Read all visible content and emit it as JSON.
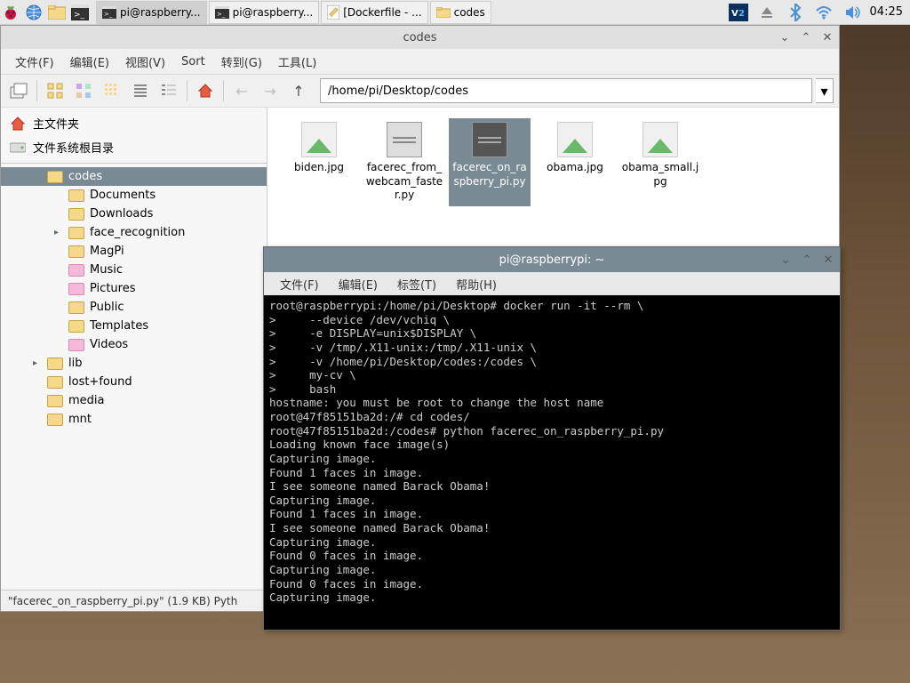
{
  "taskbar": {
    "items": [
      {
        "label": "pi@raspberry...",
        "icon": "terminal"
      },
      {
        "label": "pi@raspberry...",
        "icon": "terminal"
      },
      {
        "label": "[Dockerfile - ...",
        "icon": "editor"
      },
      {
        "label": "codes",
        "icon": "folder"
      }
    ],
    "clock": "04:25"
  },
  "file_manager": {
    "title": "codes",
    "menus": [
      "文件(F)",
      "编辑(E)",
      "视图(V)",
      "Sort",
      "转到(G)",
      "工具(L)"
    ],
    "path": "/home/pi/Desktop/codes",
    "places": [
      {
        "label": "主文件夹",
        "icon": "home"
      },
      {
        "label": "文件系统根目录",
        "icon": "drive"
      }
    ],
    "tree": [
      {
        "label": "codes",
        "level": 1,
        "selected": true
      },
      {
        "label": "Documents",
        "level": 2
      },
      {
        "label": "Downloads",
        "level": 2
      },
      {
        "label": "face_recognition",
        "level": 2,
        "expandable": true
      },
      {
        "label": "MagPi",
        "level": 2
      },
      {
        "label": "Music",
        "level": 2,
        "pink": true
      },
      {
        "label": "Pictures",
        "level": 2,
        "pink": true
      },
      {
        "label": "Public",
        "level": 2
      },
      {
        "label": "Templates",
        "level": 2
      },
      {
        "label": "Videos",
        "level": 2,
        "pink": true
      },
      {
        "label": "lib",
        "level": 1,
        "expandable": true
      },
      {
        "label": "lost+found",
        "level": 1
      },
      {
        "label": "media",
        "level": 1
      },
      {
        "label": "mnt",
        "level": 1
      }
    ],
    "files": [
      {
        "name": "biden.jpg",
        "type": "image"
      },
      {
        "name": "facerec_from_webcam_faster.py",
        "type": "text"
      },
      {
        "name": "facerec_on_raspberry_pi.py",
        "type": "text-dark",
        "selected": true
      },
      {
        "name": "obama.jpg",
        "type": "image"
      },
      {
        "name": "obama_small.jpg",
        "type": "image"
      }
    ],
    "status": "\"facerec_on_raspberry_pi.py\" (1.9 KB) Pyth"
  },
  "terminal": {
    "title": "pi@raspberrypi: ~",
    "menus": [
      "文件(F)",
      "编辑(E)",
      "标签(T)",
      "帮助(H)"
    ],
    "lines": [
      "root@raspberrypi:/home/pi/Desktop# docker run -it --rm \\",
      ">     --device /dev/vchiq \\",
      ">     -e DISPLAY=unix$DISPLAY \\",
      ">     -v /tmp/.X11-unix:/tmp/.X11-unix \\",
      ">     -v /home/pi/Desktop/codes:/codes \\",
      ">     my-cv \\",
      ">     bash",
      "hostname: you must be root to change the host name",
      "root@47f85151ba2d:/# cd codes/",
      "root@47f85151ba2d:/codes# python facerec_on_raspberry_pi.py",
      "Loading known face image(s)",
      "Capturing image.",
      "Found 1 faces in image.",
      "I see someone named Barack Obama!",
      "Capturing image.",
      "Found 1 faces in image.",
      "I see someone named Barack Obama!",
      "Capturing image.",
      "Found 0 faces in image.",
      "Capturing image.",
      "Found 0 faces in image.",
      "Capturing image."
    ]
  }
}
